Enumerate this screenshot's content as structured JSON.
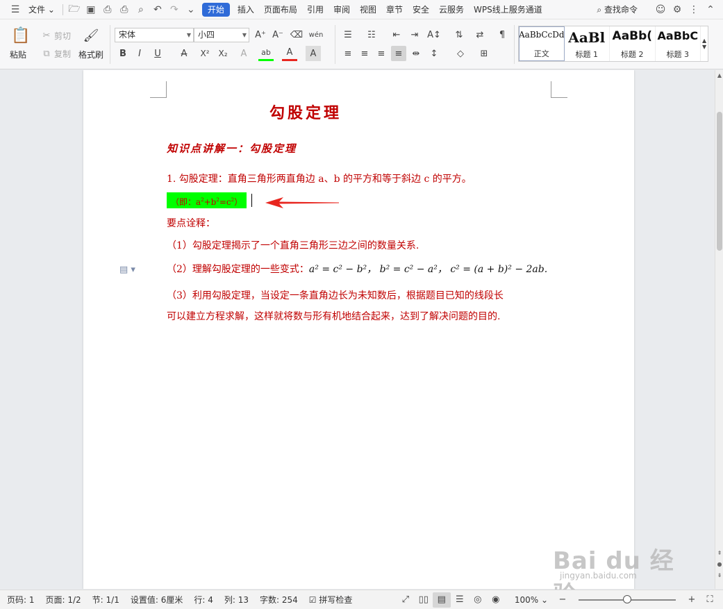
{
  "menubar": {
    "file_label": "文件",
    "tabs": [
      "开始",
      "插入",
      "页面布局",
      "引用",
      "审阅",
      "视图",
      "章节",
      "安全",
      "云服务",
      "WPS线上服务通道"
    ],
    "active_tab": "开始",
    "search_label": "查找命令"
  },
  "ribbon": {
    "paste": "粘贴",
    "cut": "剪切",
    "copy": "复制",
    "format_painter": "格式刷",
    "font_name": "宋体",
    "font_size": "小四",
    "styles": [
      {
        "sample": "AaBbCcDd",
        "name": "正文"
      },
      {
        "sample": "AaBl",
        "name": "标题 1"
      },
      {
        "sample": "AaBb(",
        "name": "标题 2"
      },
      {
        "sample": "AaBbC",
        "name": "标题 3"
      }
    ]
  },
  "document": {
    "title": "勾股定理",
    "section_title": "知识点讲解一：勾股定理",
    "line1": "1. 勾股定理：直角三角形两直角边 a、b 的平方和等于斜边 c 的平方。",
    "formula_prefix": "（即：a",
    "formula_mid1": "+b",
    "formula_mid2": "=c",
    "formula_suffix": "）",
    "sup2": "2",
    "notes_heading": "要点诠释：",
    "point1": "（1）勾股定理揭示了一个直角三角形三边之间的数量关系.",
    "point2_text": "（2）理解勾股定理的一些变式：",
    "point2_formulas": "a² = c² − b²， b² = c² − a²，  c² = (a + b)² − 2ab.",
    "point3_line1": "（3）利用勾股定理，当设定一条直角边长为未知数后，根据题目已知的线段长",
    "point3_line2": "可以建立方程求解，这样就将数与形有机地结合起来，达到了解决问题的目的."
  },
  "statusbar": {
    "page": "页码: 1",
    "pages": "页面: 1/2",
    "section": "节: 1/1",
    "setting": "设置值: 6厘米",
    "row": "行: 4",
    "col": "列: 13",
    "wordcount": "字数: 254",
    "spellcheck": "拼写检查",
    "zoom": "100%",
    "zoom_level": 0.5
  },
  "watermark": {
    "main": "Bai du 经验",
    "sub": "jingyan.baidu.com"
  },
  "colors": {
    "accent": "#2f6bd8",
    "doc_red": "#c00000",
    "highlight": "#00ff00",
    "arrow": "#e8261f"
  }
}
